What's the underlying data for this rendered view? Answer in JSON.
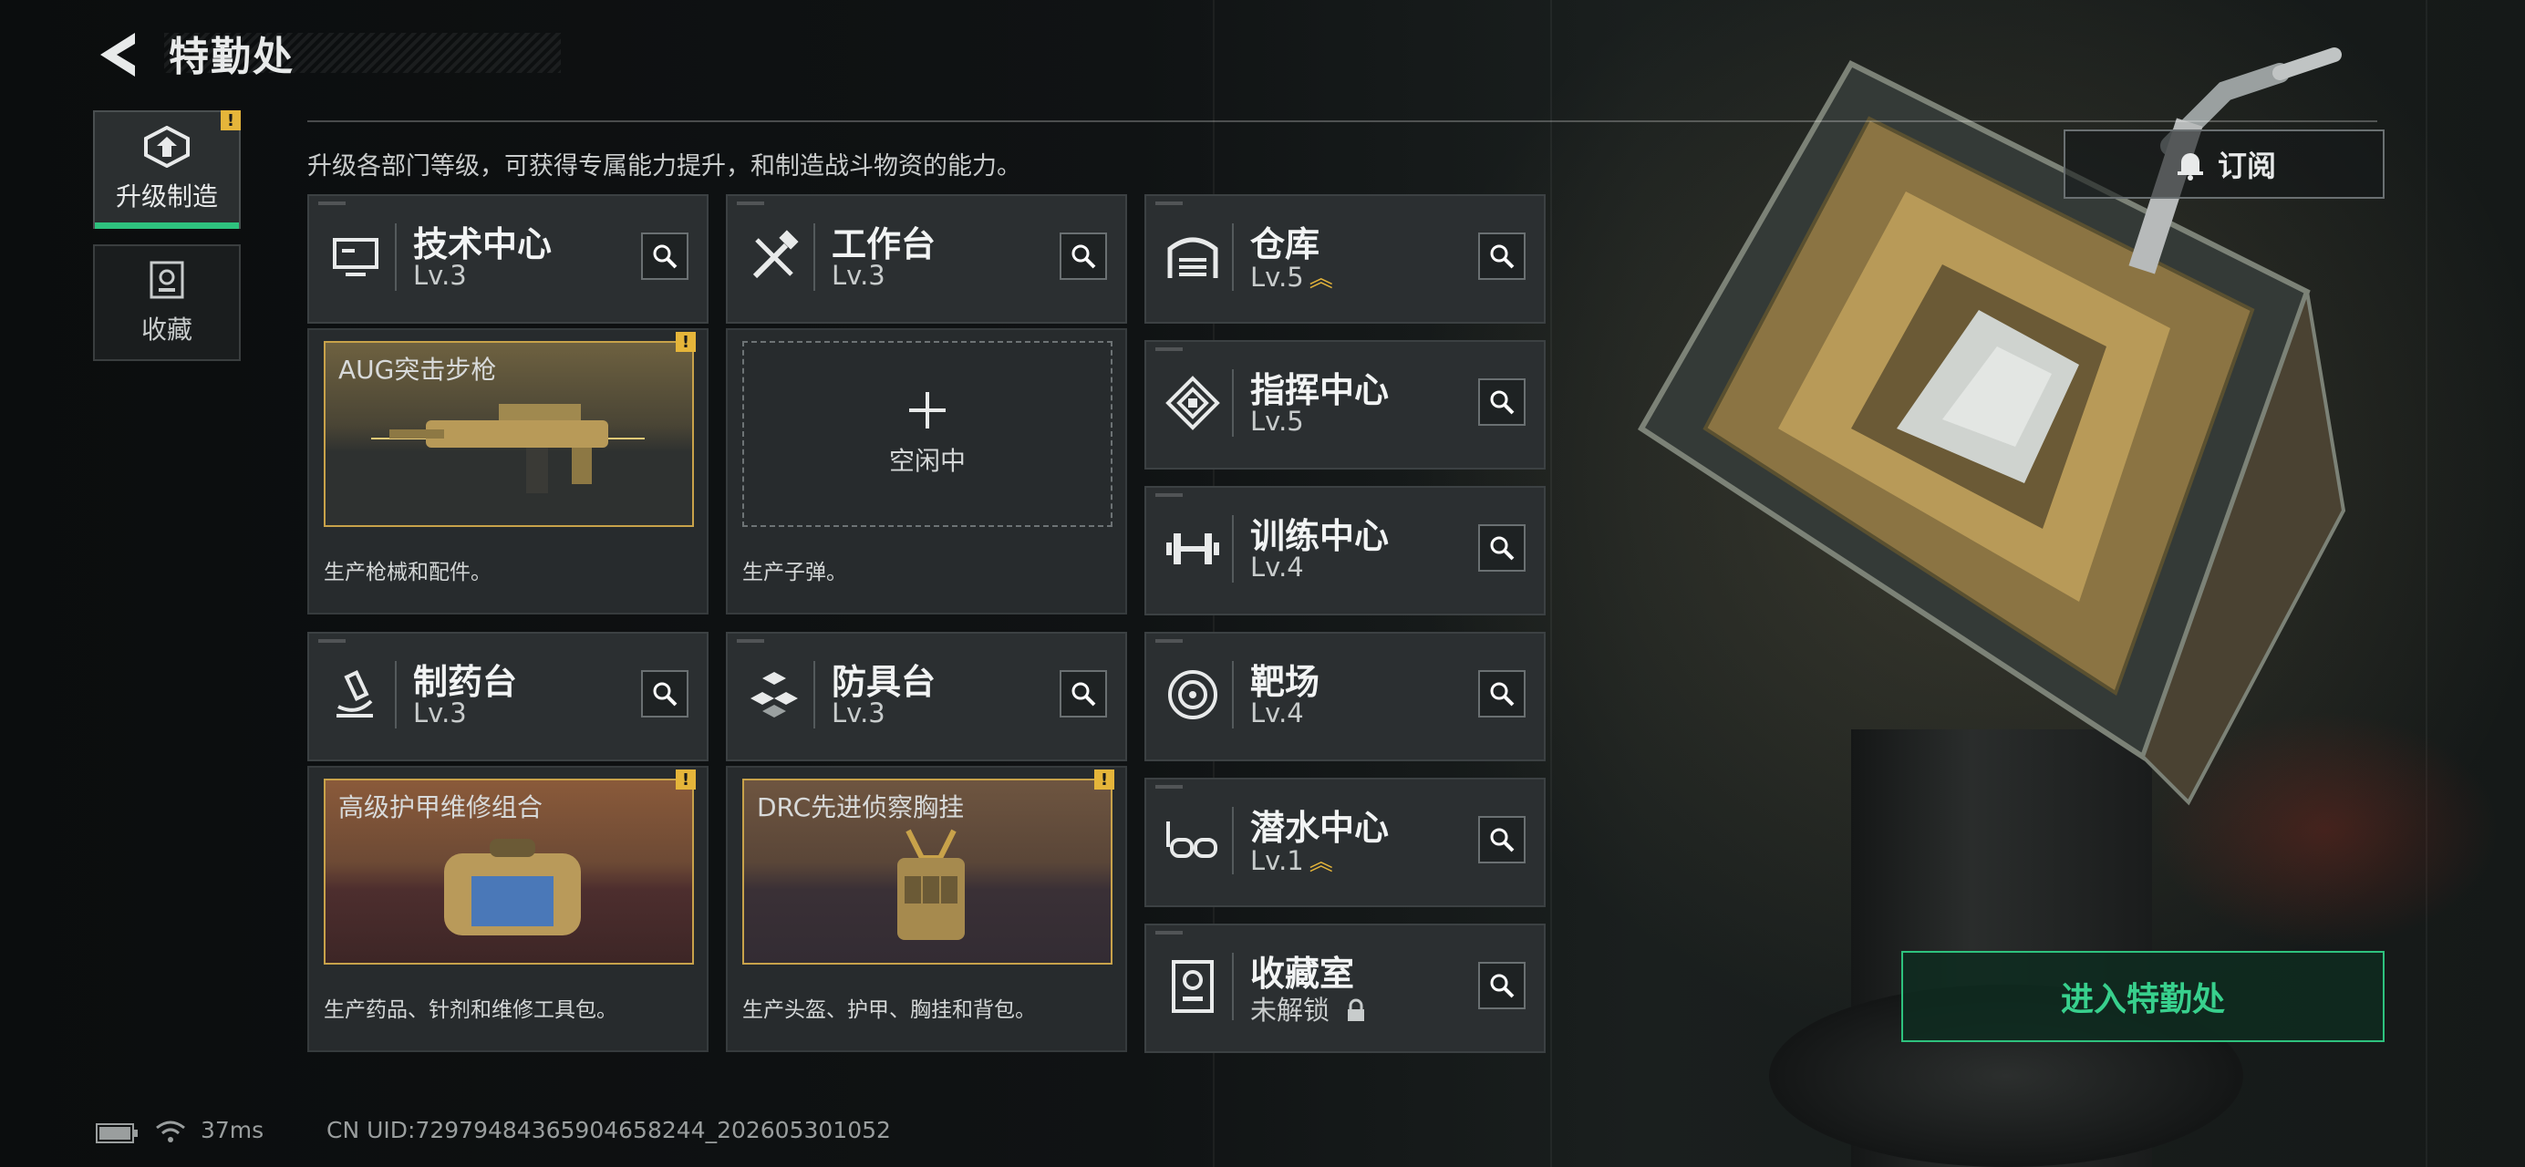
{
  "header": {
    "title": "特勤处"
  },
  "tabs": [
    {
      "label": "升级制造",
      "active": true,
      "alert": "!"
    },
    {
      "label": "收藏",
      "active": false
    }
  ],
  "description": "升级各部门等级，可获得专属能力提升，和制造战斗物资的能力。",
  "subscribe_label": "订阅",
  "enter_label": "进入特勤处",
  "departments": {
    "tech": {
      "name": "技术中心",
      "level": "Lv.3",
      "icon": "tech-monitor-icon"
    },
    "workbench": {
      "name": "工作台",
      "level": "Lv.3",
      "icon": "tools-icon"
    },
    "pharma": {
      "name": "制药台",
      "level": "Lv.3",
      "icon": "microscope-icon"
    },
    "armor": {
      "name": "防具台",
      "level": "Lv.3",
      "icon": "blocks-icon"
    },
    "warehouse": {
      "name": "仓库",
      "level": "Lv.5",
      "icon": "garage-icon",
      "upgrade": "︽"
    },
    "command": {
      "name": "指挥中心",
      "level": "Lv.5",
      "icon": "chip-icon"
    },
    "training": {
      "name": "训练中心",
      "level": "Lv.4",
      "icon": "dumbbell-icon"
    },
    "range": {
      "name": "靶场",
      "level": "Lv.4",
      "icon": "target-icon"
    },
    "diving": {
      "name": "潜水中心",
      "level": "Lv.1",
      "icon": "goggles-icon",
      "upgrade": "︽"
    },
    "collection": {
      "name": "收藏室",
      "level": "未解锁",
      "icon": "trophy-case-icon",
      "locked": true
    }
  },
  "production": {
    "tech": {
      "item": "AUG突击步枪",
      "caption": "生产枪械和配件。",
      "alert": "!"
    },
    "workbench": {
      "item": "空闲中",
      "caption": "生产子弹。"
    },
    "pharma": {
      "item": "高级护甲维修组合",
      "caption": "生产药品、针剂和维修工具包。",
      "alert": "!"
    },
    "armor": {
      "item": "DRC先进侦察胸挂",
      "caption": "生产头盔、护甲、胸挂和背包。",
      "alert": "!"
    }
  },
  "status": {
    "ping": "37ms",
    "uid": "CN UID:7297948436590465​8244_202605301052"
  },
  "colors": {
    "accent": "#2ec27e",
    "alert": "#e5b53a",
    "gold": "#c8a24a"
  }
}
